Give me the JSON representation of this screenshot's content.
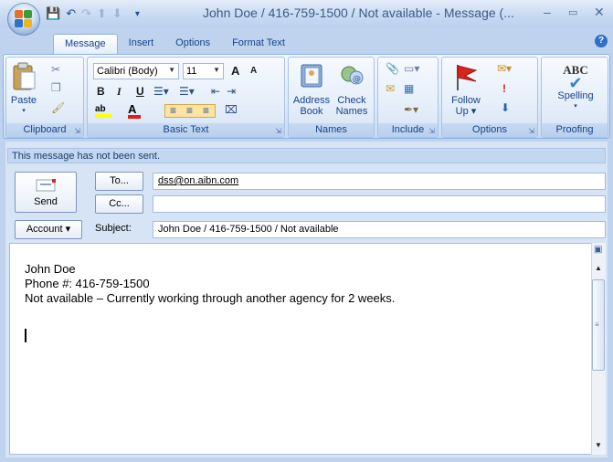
{
  "window": {
    "title": "John Doe / 416-759-1500 / Not available - Message (...",
    "minimize": "–",
    "maximize": "▭",
    "close": "✕"
  },
  "qat": {
    "dropdown": "▾"
  },
  "tabs": [
    "Message",
    "Insert",
    "Options",
    "Format Text"
  ],
  "help": "?",
  "ribbon": {
    "clipboard": {
      "label": "Clipboard",
      "paste": "Paste",
      "paste_arrow": "▾"
    },
    "basic_text": {
      "label": "Basic Text",
      "font": "Calibri (Body)",
      "size": "11",
      "grow": "A",
      "shrink": "A",
      "bold": "B",
      "italic": "I",
      "underline": "U",
      "highlight": "ab",
      "font_color": "A"
    },
    "names": {
      "label": "Names",
      "address_book": [
        "Address",
        "Book"
      ],
      "check_names": [
        "Check",
        "Names"
      ]
    },
    "include": {
      "label": "Include"
    },
    "options": {
      "label": "Options",
      "follow_up": [
        "Follow",
        "Up ▾"
      ]
    },
    "proofing": {
      "label": "Proofing",
      "spelling": "Spelling",
      "abc": "ABC"
    }
  },
  "info_bar": "This message has not been sent.",
  "send": "Send",
  "to_button": "To...",
  "cc_button": "Cc...",
  "to_value": "dss@on.aibn.com",
  "cc_value": "",
  "account_button": "Account ▾",
  "subject_label": "Subject:",
  "subject_value": "John Doe / 416-759-1500 / Not available",
  "body_lines": [
    "John Doe",
    "Phone #: 416-759-1500",
    "Not available – Currently working through another agency for 2 weeks."
  ],
  "colors": {
    "accent": "#15428b",
    "ribbon_border": "#8db2e3",
    "flag_red": "#d9241b"
  }
}
